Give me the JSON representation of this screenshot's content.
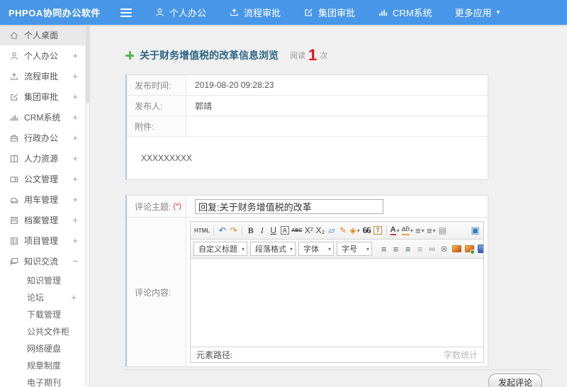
{
  "colors": {
    "topbar_blue": "#4896e8",
    "title_color": "#2d6684",
    "read_count_red": "#ee1111",
    "plus_green": "#55b54a",
    "panel_accent_border": "#a9c9e6",
    "sidebar_active_bg": "#e9e9e9"
  },
  "topbar": {
    "logo": "PHPOA协同办公软件",
    "nav": [
      {
        "name": "nav-personal-office",
        "icon": "#i-user",
        "label": "个人办公"
      },
      {
        "name": "nav-workflow-approval",
        "icon": "#i-up",
        "label": "流程审批"
      },
      {
        "name": "nav-group-approval",
        "icon": "#i-edit",
        "label": "集团审批"
      },
      {
        "name": "nav-crm",
        "icon": "#i-chart",
        "label": "CRM系统"
      },
      {
        "name": "nav-more-apps",
        "label": "更多应用",
        "caret": "▾"
      }
    ]
  },
  "sidebar": {
    "items": [
      {
        "name": "sidebar-item-desktop",
        "icon": "#i-home",
        "label": "个人桌面",
        "cls": "active"
      },
      {
        "name": "sidebar-item-personal-office",
        "icon": "#i-user",
        "label": "个人办公",
        "expand": "+"
      },
      {
        "name": "sidebar-item-workflow-approval",
        "icon": "#i-up",
        "label": "流程审批",
        "expand": "+"
      },
      {
        "name": "sidebar-item-group-approval",
        "icon": "#i-edit",
        "label": "集团审批",
        "expand": "+"
      },
      {
        "name": "sidebar-item-crm",
        "icon": "#i-chart",
        "label": "CRM系统",
        "expand": "+"
      },
      {
        "name": "sidebar-item-admin-office",
        "icon": "#i-brief",
        "label": "行政办公",
        "expand": "+"
      },
      {
        "name": "sidebar-item-hr",
        "icon": "#i-book",
        "label": "人力资源",
        "expand": "+"
      },
      {
        "name": "sidebar-item-official-doc",
        "icon": "#i-card",
        "label": "公文管理",
        "expand": "+"
      },
      {
        "name": "sidebar-item-vehicle",
        "icon": "#i-car",
        "label": "用车管理",
        "expand": "+"
      },
      {
        "name": "sidebar-item-archive",
        "icon": "#i-save",
        "label": "档案管理",
        "expand": "+"
      },
      {
        "name": "sidebar-item-project",
        "icon": "#i-proj",
        "label": "项目管理",
        "expand": "+"
      },
      {
        "name": "sidebar-item-knowledge-exchange",
        "icon": "#i-chat",
        "label": "知识交流",
        "expand": "−"
      }
    ],
    "subitems": [
      {
        "name": "sidebar-subitem-knowledge-mgmt",
        "label": "知识管理"
      },
      {
        "name": "sidebar-subitem-forum",
        "label": "论坛",
        "expand": "+"
      },
      {
        "name": "sidebar-subitem-download",
        "label": "下载管理"
      },
      {
        "name": "sidebar-subitem-public-cabinet",
        "label": "公共文件柜"
      },
      {
        "name": "sidebar-subitem-network-disk",
        "label": "网络硬盘"
      },
      {
        "name": "sidebar-subitem-rules",
        "label": "规章制度"
      },
      {
        "name": "sidebar-subitem-ejournal",
        "label": "电子期刊"
      }
    ]
  },
  "article": {
    "title": "关于财务增值税的改革信息浏览",
    "read_label": "阅读",
    "read_count": "1",
    "read_unit": "次",
    "fields": [
      {
        "label": "发布时间:",
        "value": "2019-08-20 09:28:23"
      },
      {
        "label": "发布人:",
        "value": "郭靖"
      },
      {
        "label": "附件:",
        "value": ""
      }
    ],
    "content": "XXXXXXXXX"
  },
  "comment_form": {
    "subject_label": "评论主题:",
    "required_mark": "(*)",
    "subject_value": "回复:关于财务增值税的改革",
    "content_label": "评论内容:",
    "editor": {
      "toolbar1": [
        {
          "name": "html-source-button",
          "glyph": "HTML",
          "cls": "t-html"
        },
        {
          "name": "toolbar-separator",
          "cls": "t-sep",
          "inter": "false"
        },
        {
          "name": "undo-icon",
          "glyph": "↶",
          "cls": "t-blue"
        },
        {
          "name": "redo-icon",
          "glyph": "↷",
          "cls": "t-orange"
        },
        {
          "name": "toolbar-separator",
          "cls": "t-sep",
          "inter": "false"
        },
        {
          "name": "bold-button",
          "glyph": "B",
          "cls": "t-bold"
        },
        {
          "name": "italic-button",
          "glyph": "I",
          "cls": "t-italic"
        },
        {
          "name": "underline-button",
          "glyph": "U",
          "cls": "t-underline"
        },
        {
          "name": "font-border-button",
          "glyph": "A",
          "cls": "t-boxed"
        },
        {
          "name": "strikethrough-button",
          "glyph": "ABC",
          "cls": "t-strike"
        },
        {
          "name": "superscript-button",
          "glyph": "X²"
        },
        {
          "name": "subscript-button",
          "glyph": "X₂"
        },
        {
          "name": "eraser-icon",
          "glyph": "▱",
          "cls": "t-blue"
        },
        {
          "name": "format-painter-icon",
          "glyph": "✎",
          "cls": "t-orange"
        },
        {
          "name": "text-style-dropdown",
          "glyph": "◈",
          "cls": "t-orange",
          "caret": "▾"
        },
        {
          "name": "blockquote-button",
          "glyph": "66",
          "cls": "t-quote"
        },
        {
          "name": "insert-template-button",
          "glyph": "T",
          "cls": "t-boxed-o"
        },
        {
          "name": "toolbar-separator",
          "cls": "t-sep",
          "inter": "false"
        },
        {
          "name": "font-color-dropdown",
          "glyph": "A",
          "cls": "t-fontcolor",
          "caret": "▾"
        },
        {
          "name": "highlight-color-dropdown",
          "glyph": "ab",
          "cls": "t-highlight",
          "caret": "▾"
        },
        {
          "name": "ordered-list-dropdown",
          "glyph": "≡",
          "cls": "t-al",
          "caret": "▾"
        },
        {
          "name": "unordered-list-dropdown",
          "glyph": "≡",
          "cls": "t-al",
          "caret": "▾"
        },
        {
          "name": "new-page-button",
          "glyph": "▤",
          "cls": "t-page"
        },
        {
          "name": "fullscreen-button",
          "glyph": "▣",
          "cls": "t-screen"
        }
      ],
      "toolbar2_dropdowns": [
        {
          "name": "custom-title-dropdown",
          "label": "自定义标题",
          "caret": "▾"
        },
        {
          "name": "paragraph-format-dropdown",
          "label": "段落格式",
          "caret": "▾"
        },
        {
          "name": "font-family-dropdown",
          "label": "字体",
          "caret": "▾"
        },
        {
          "name": "font-size-dropdown",
          "label": "字号",
          "caret": "▾"
        }
      ],
      "toolbar2_icons": [
        {
          "name": "align-left-button",
          "glyph": "≡",
          "cls": "t-al"
        },
        {
          "name": "align-center-button",
          "glyph": "≡",
          "cls": "t-al"
        },
        {
          "name": "align-right-button",
          "glyph": "≡",
          "cls": "t-al"
        },
        {
          "name": "align-justify-button",
          "glyph": "≡",
          "cls": "t-al t-dim"
        },
        {
          "name": "link-button",
          "glyph": "∞",
          "cls": "t-gray"
        },
        {
          "name": "unlink-button",
          "glyph": "⊗",
          "cls": "t-gray"
        },
        {
          "name": "insert-image-button",
          "glyph": "",
          "cls": "t-img"
        },
        {
          "name": "scrawl-button",
          "glyph": "",
          "cls": "t-img t-img2"
        },
        {
          "name": "insert-video-button",
          "glyph": "",
          "cls": "t-video"
        },
        {
          "name": "insert-table-button",
          "glyph": "⊞",
          "cls": "t-table"
        }
      ],
      "status_left": "元素路径:",
      "status_right": "字数统计"
    },
    "submit_label": "发起评论"
  }
}
